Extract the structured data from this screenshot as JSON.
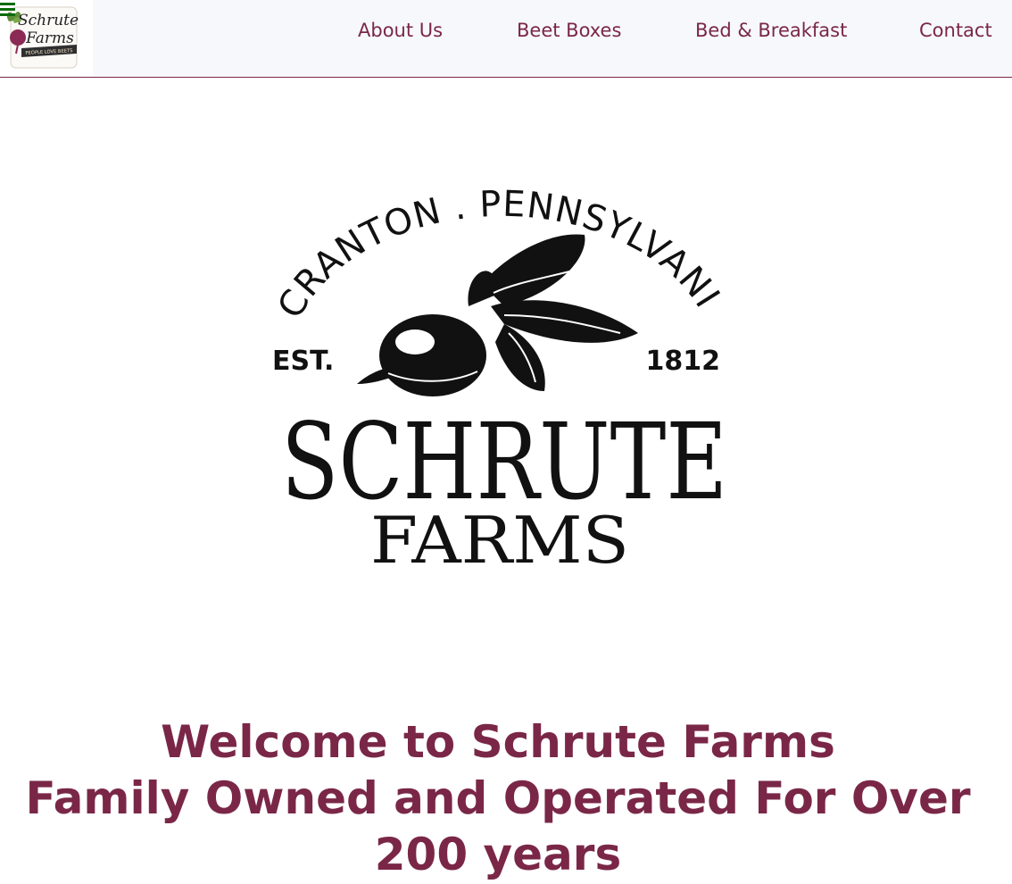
{
  "header": {
    "logo": {
      "line1": "Schrute",
      "line2": "Farms",
      "tagline": "PEOPLE LOVE BEETS"
    },
    "menu_icon": "hamburger-icon",
    "nav": [
      {
        "label": "About Us"
      },
      {
        "label": "Beet Boxes"
      },
      {
        "label": "Bed & Breakfast"
      },
      {
        "label": "Contact"
      }
    ]
  },
  "hero_logo": {
    "arc_text": "SCRANTON . PENNSYLVANIA",
    "est_label": "EST.",
    "est_year": "1812",
    "name_main": "SCHRUTE",
    "name_sub": "FARMS"
  },
  "welcome": {
    "line1": "Welcome to Schrute Farms",
    "line2": "Family Owned and Operated For Over 200 years"
  },
  "colors": {
    "brand": "#7a2747",
    "nav_bg": "#f7f8fc",
    "menu_icon": "#0d6b0d"
  }
}
